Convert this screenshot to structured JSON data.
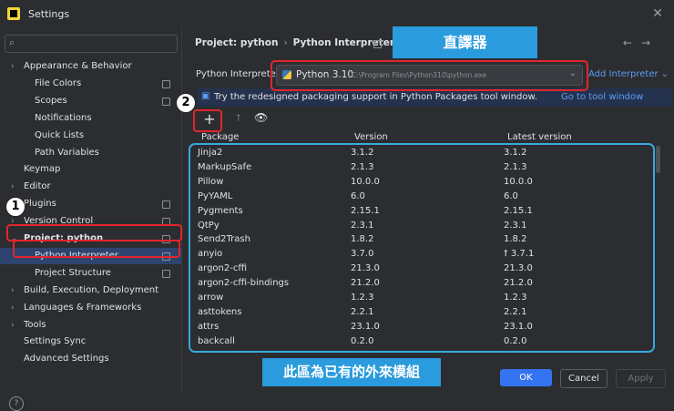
{
  "window": {
    "title": "Settings"
  },
  "sidebar": {
    "items": [
      {
        "label": "Appearance & Behavior",
        "indent": 1,
        "expandable": true,
        "bold": false
      },
      {
        "label": "File Colors",
        "indent": 2,
        "mark": true
      },
      {
        "label": "Scopes",
        "indent": 2,
        "mark": true
      },
      {
        "label": "Notifications",
        "indent": 2
      },
      {
        "label": "Quick Lists",
        "indent": 2
      },
      {
        "label": "Path Variables",
        "indent": 2
      },
      {
        "label": "Keymap",
        "indent": 1
      },
      {
        "label": "Editor",
        "indent": 1,
        "expandable": true
      },
      {
        "label": "Plugins",
        "indent": 1,
        "mark": true
      },
      {
        "label": "Version Control",
        "indent": 1,
        "expandable": true,
        "mark": true
      },
      {
        "label": "Project: python",
        "indent": 1,
        "expanded": true,
        "mark": true,
        "bold": true
      },
      {
        "label": "Python Interpreter",
        "indent": 2,
        "mark": true,
        "selected": true
      },
      {
        "label": "Project Structure",
        "indent": 2,
        "mark": true
      },
      {
        "label": "Build, Execution, Deployment",
        "indent": 1,
        "expandable": true
      },
      {
        "label": "Languages & Frameworks",
        "indent": 1,
        "expandable": true
      },
      {
        "label": "Tools",
        "indent": 1,
        "expandable": true
      },
      {
        "label": "Settings Sync",
        "indent": 1
      },
      {
        "label": "Advanced Settings",
        "indent": 1
      }
    ]
  },
  "breadcrumb": {
    "project": "Project: python",
    "page": "Python Interpreter"
  },
  "interpreter": {
    "label": "Python Interpreter:",
    "name": "Python 3.10",
    "path": "C:\\Program Files\\Python310\\python.exe",
    "add_label": "Add Interpreter"
  },
  "banner": {
    "text": "Try the redesigned packaging support in Python Packages tool window.",
    "link": "Go to tool window"
  },
  "table": {
    "headers": {
      "package": "Package",
      "version": "Version",
      "latest": "Latest version"
    },
    "rows": [
      {
        "package": "Jinja2",
        "version": "3.1.2",
        "latest": "3.1.2"
      },
      {
        "package": "MarkupSafe",
        "version": "2.1.3",
        "latest": "2.1.3"
      },
      {
        "package": "Pillow",
        "version": "10.0.0",
        "latest": "10.0.0"
      },
      {
        "package": "PyYAML",
        "version": "6.0",
        "latest": "6.0"
      },
      {
        "package": "Pygments",
        "version": "2.15.1",
        "latest": "2.15.1"
      },
      {
        "package": "QtPy",
        "version": "2.3.1",
        "latest": "2.3.1"
      },
      {
        "package": "Send2Trash",
        "version": "1.8.2",
        "latest": "1.8.2"
      },
      {
        "package": "anyio",
        "version": "3.7.0",
        "latest": "⭡ 3.7.1"
      },
      {
        "package": "argon2-cffi",
        "version": "21.3.0",
        "latest": "21.3.0"
      },
      {
        "package": "argon2-cffi-bindings",
        "version": "21.2.0",
        "latest": "21.2.0"
      },
      {
        "package": "arrow",
        "version": "1.2.3",
        "latest": "1.2.3"
      },
      {
        "package": "asttokens",
        "version": "2.2.1",
        "latest": "2.2.1"
      },
      {
        "package": "attrs",
        "version": "23.1.0",
        "latest": "23.1.0"
      },
      {
        "package": "backcall",
        "version": "0.2.0",
        "latest": "0.2.0"
      }
    ]
  },
  "buttons": {
    "ok": "OK",
    "cancel": "Cancel",
    "apply": "Apply"
  },
  "annotations": {
    "callout_top": "直譯器",
    "callout_bottom": "此區為已有的外來模組",
    "step1": "1",
    "step2": "2"
  },
  "colors": {
    "accent": "#3574f0",
    "annotation_red": "#e2252d",
    "annotation_blue": "#2a9bdc"
  }
}
